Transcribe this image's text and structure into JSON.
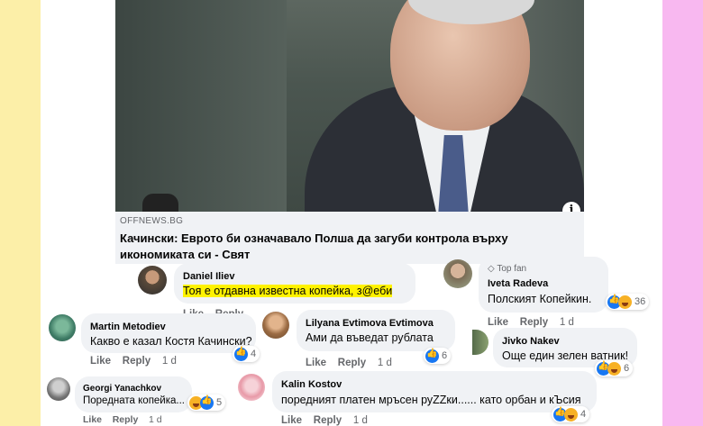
{
  "preview": {
    "domain": "OFFNEWS.BG",
    "headline": "Качински: Еврото би означавало Полша да загуби контрола върху икономиката си - Свят"
  },
  "labels": {
    "like": "Like",
    "reply": "Reply"
  },
  "comments": {
    "daniel": {
      "name": "Daniel Iliev",
      "text": "Тоя е отдавна известна копейка, з@еби"
    },
    "iveta": {
      "badge": "Top fan",
      "name": "Iveta Radeva",
      "text": "Полският Копейкин.",
      "count": "36",
      "time": "1 d"
    },
    "martin": {
      "name": "Martin Metodiev",
      "text": "Какво е казал Костя Качински?",
      "count": "4",
      "time": "1 d"
    },
    "lilyana": {
      "name": "Lilyana Evtimova Evtimova",
      "text": "Ами да въведат рублата",
      "count": "6",
      "time": "1 d"
    },
    "jivko": {
      "name": "Jivko Nakev",
      "text": "Още един зелен ватник!",
      "count": "6"
    },
    "georgi": {
      "name": "Georgi Yanachkov",
      "text": "Поредната копейка...",
      "count": "5",
      "time": "1 d"
    },
    "kalin": {
      "name": "Kalin Kostov",
      "text": "поредният платен мръсен руZZки...... като орбан и кЪсия",
      "count": "4",
      "time": "1 d"
    }
  },
  "colors": {
    "left_border": "#fcefa8",
    "right_border": "#f8b8f0",
    "highlight": "#fff200",
    "like_blue": "#1877f2"
  }
}
